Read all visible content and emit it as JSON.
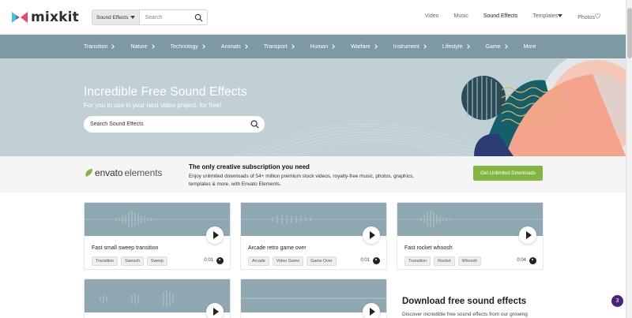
{
  "header": {
    "logo": "mixkit",
    "search_category": "Sound Effects",
    "search_placeholder": "Search",
    "nav": [
      "Video",
      "Music",
      "Sound Effects",
      "Templates",
      "Photos"
    ],
    "active": "Sound Effects"
  },
  "categories": [
    "Transition",
    "Nature",
    "Technology",
    "Animals",
    "Transport",
    "Human",
    "Warfare",
    "Instrument",
    "Lifestyle",
    "Game",
    "More"
  ],
  "hero": {
    "title": "Incredible Free Sound Effects",
    "subtitle": "For you to use in your next video project, for free!",
    "search_placeholder": "Search Sound Effects"
  },
  "envato": {
    "logo_a": "envato",
    "logo_b": "elements",
    "title": "The only creative subscription you need",
    "desc_line1": "Enjoy unlimited downloads of 54+ million premium stock videos, royalty-free music, photos, graphics,",
    "desc_line2": "templates & more, with Envato Elements.",
    "button": "Get Unlimited Downloads"
  },
  "cards": [
    {
      "title": "Fast small sweep transition",
      "tags": [
        "Transition",
        "Swoosh",
        "Sweep"
      ],
      "duration": "0:01"
    },
    {
      "title": "Arcade retro game over",
      "tags": [
        "Arcade",
        "Video Game",
        "Game Over"
      ],
      "duration": "0:01"
    },
    {
      "title": "Fast rocket whoosh",
      "tags": [
        "Transition",
        "Rocket",
        "Whoosh"
      ],
      "duration": "0:04"
    }
  ],
  "download": {
    "title": "Download free sound effects",
    "desc": "Discover incredible free sound effects from our growing"
  },
  "badge": "3",
  "colors": {
    "category_bar": "#7e99a3",
    "hero_bg": "#c1d0d5",
    "button_green": "#82b541",
    "waveform_bg": "#8fa7b1"
  }
}
